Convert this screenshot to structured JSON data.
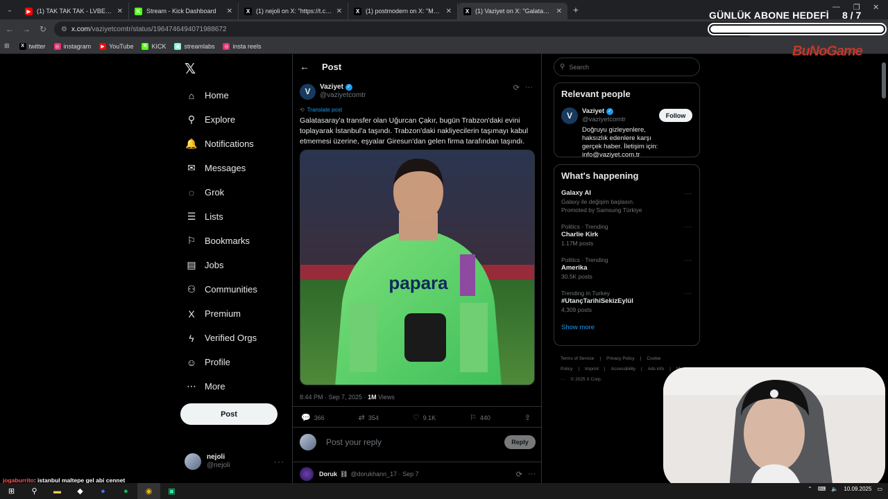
{
  "browser": {
    "tabs": [
      {
        "title": "(1) TAK TAK TAK - LVBEL C5 X II",
        "favicon_color": "#ff0000",
        "favicon_glyph": "▶"
      },
      {
        "title": "Stream - Kick Dashboard",
        "favicon_color": "#53fc18",
        "favicon_glyph": "K"
      },
      {
        "title": "(1) nejoli on X: \"https://t.co/cz0",
        "favicon_color": "#000000",
        "favicon_glyph": "X"
      },
      {
        "title": "(1) postmodern on X: \"Manifest",
        "favicon_color": "#000000",
        "favicon_glyph": "X"
      },
      {
        "title": "(1) Vaziyet on X: \"Galatasaray'a",
        "favicon_color": "#000000",
        "favicon_glyph": "X"
      }
    ],
    "url_host": "x.com",
    "url_path": "/vaziyetcomtr/status/1964746494071988672",
    "bookmarks": [
      {
        "label": "twitter",
        "icon": "x-icon",
        "color": "#000000",
        "glyph": "X"
      },
      {
        "label": "instagram",
        "icon": "instagram-icon",
        "color": "#e1306c",
        "glyph": "◎"
      },
      {
        "label": "YouTube",
        "icon": "youtube-icon",
        "color": "#ff0000",
        "glyph": "▶"
      },
      {
        "label": "KICK",
        "icon": "kick-icon",
        "color": "#53fc18",
        "glyph": "K"
      },
      {
        "label": "streamlabs",
        "icon": "streamlabs-icon",
        "color": "#80f5d2",
        "glyph": "▣"
      },
      {
        "label": "insta reels",
        "icon": "instagram-icon",
        "color": "#e1306c",
        "glyph": "◎"
      }
    ]
  },
  "overlay": {
    "goal_title": "GÜNLÜK ABONE HEDEFİ",
    "goal_count": "8 / 7",
    "goal_progress": 1.0,
    "logo": "BuNoGame",
    "chat_user": "jogaburrito",
    "chat_message": ": istanbul maltepe gel abi cennet"
  },
  "sidebar": {
    "items": [
      {
        "label": "Home",
        "icon": "home-icon",
        "glyph": "⌂"
      },
      {
        "label": "Explore",
        "icon": "search-icon",
        "glyph": "⚲"
      },
      {
        "label": "Notifications",
        "icon": "bell-icon",
        "glyph": "🔔"
      },
      {
        "label": "Messages",
        "icon": "envelope-icon",
        "glyph": "✉"
      },
      {
        "label": "Grok",
        "icon": "grok-icon",
        "glyph": "◌"
      },
      {
        "label": "Lists",
        "icon": "list-icon",
        "glyph": "☰"
      },
      {
        "label": "Bookmarks",
        "icon": "bookmark-icon",
        "glyph": "⚐"
      },
      {
        "label": "Jobs",
        "icon": "briefcase-icon",
        "glyph": "▤"
      },
      {
        "label": "Communities",
        "icon": "people-icon",
        "glyph": "⚇"
      },
      {
        "label": "Premium",
        "icon": "x-icon",
        "glyph": "X"
      },
      {
        "label": "Verified Orgs",
        "icon": "lightning-icon",
        "glyph": "ϟ"
      },
      {
        "label": "Profile",
        "icon": "person-icon",
        "glyph": "☺"
      },
      {
        "label": "More",
        "icon": "more-circle-icon",
        "glyph": "⋯"
      }
    ],
    "post_button": "Post",
    "user_display": "nejoli",
    "user_handle": "@nejoli"
  },
  "post": {
    "header": "Post",
    "author_name": "Vaziyet",
    "author_handle": "@vaziyetcomtr",
    "translate": "Translate post",
    "text": "Galatasaray'a transfer olan Uğurcan Çakır, bugün Trabzon'daki evini toplayarak İstanbul'a taşındı. Trabzon'daki nakliyecilerin taşımayı kabul etmemesi üzerine, eşyalar Giresun'dan gelen firma tarafından taşındı.",
    "timestamp": "8:44 PM · Sep 7, 2025 · ",
    "views_value": "1M",
    "views_label": " Views",
    "jersey_sponsor": "papara",
    "replies": "366",
    "reposts": "354",
    "likes": "9.1K",
    "bookmarks": "440",
    "reply_placeholder": "Post your reply",
    "reply_button": "Reply",
    "comment_name": "Doruk",
    "comment_emoji": "⛓",
    "comment_handle": "@dorukhann_17 · Sep 7"
  },
  "right": {
    "search_placeholder": "Search",
    "relevant_title": "Relevant people",
    "rp_name": "Vaziyet",
    "rp_handle": "@vaziyetcomtr",
    "rp_bio": "Doğruyu gizleyenlere, haksızlık edenlere karşı gerçek haber. İletişim için: info@vaziyet.com.tr",
    "follow": "Follow",
    "happening_title": "What's happening",
    "trends": [
      {
        "meta": "",
        "name": "Galaxy AI",
        "sub": "Galaxy ile değişim başlasın.",
        "sub2": "Promoted by Samsung Türkiye"
      },
      {
        "meta": "Politics · Trending",
        "name": "Charlie Kirk",
        "sub": "1.17M posts",
        "sub2": ""
      },
      {
        "meta": "Politics · Trending",
        "name": "Amerika",
        "sub": "30.5K posts",
        "sub2": ""
      },
      {
        "meta": "Trending in Turkey",
        "name": "#UtançTarihiSekizEylül",
        "sub": "4,309 posts",
        "sub2": ""
      }
    ],
    "show_more": "Show more",
    "footer": [
      "Terms of Service",
      "|",
      "Privacy Policy",
      "|",
      "Cookie Policy",
      "|",
      "Imprint",
      "|",
      "Accessibility",
      "|",
      "Ads info",
      "|",
      "More ···",
      "© 2025 X Corp."
    ]
  },
  "taskbar": {
    "date": "10.09.2025"
  }
}
